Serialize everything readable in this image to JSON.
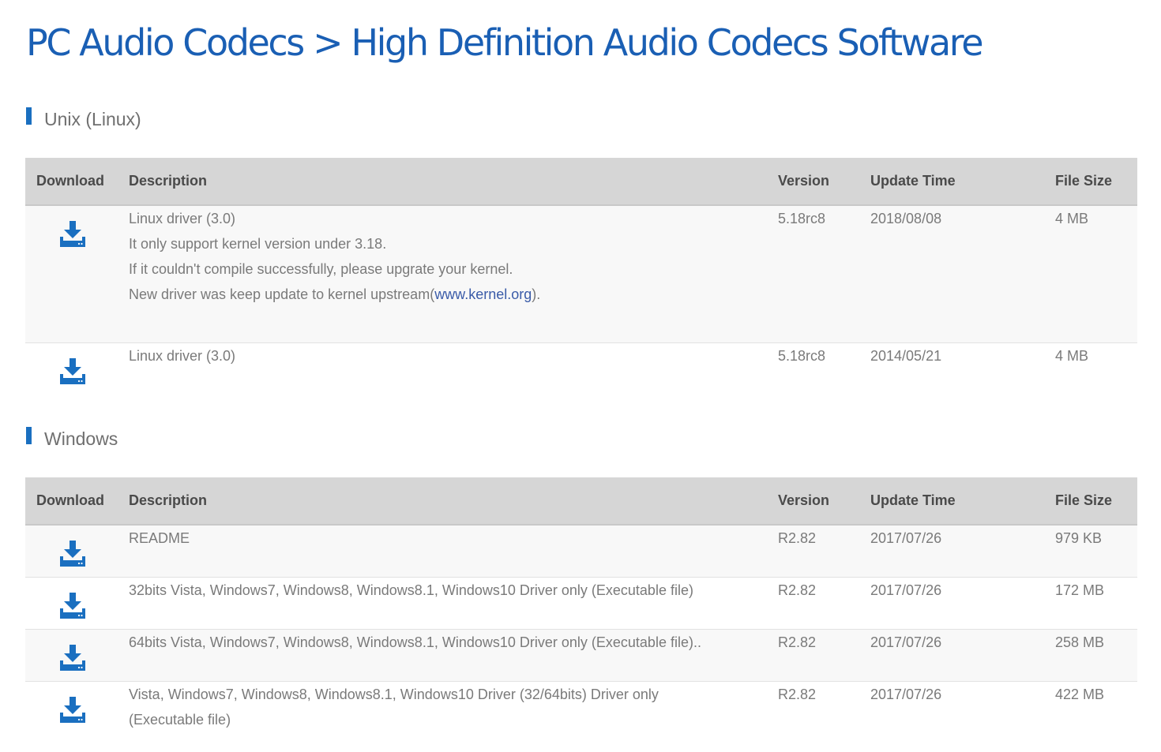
{
  "page": {
    "title": "PC Audio Codecs > High Definition Audio Codecs Software"
  },
  "table_headers": {
    "download": "Download",
    "description": "Description",
    "version": "Version",
    "update_time": "Update Time",
    "file_size": "File Size"
  },
  "icon": "download-icon",
  "accent_color": "#1a6fc0",
  "sections": {
    "linux": {
      "heading": "Unix (Linux)",
      "rows": [
        {
          "desc_line1": "Linux driver (3.0)",
          "desc_line2": "It only support kernel version under 3.18.",
          "desc_line3": "If it couldn't compile successfully, please upgrate your kernel.",
          "desc_line4_prefix": "New driver was keep update to kernel upstream(",
          "desc_link": "www.kernel.org",
          "desc_line4_suffix": ").",
          "version": "5.18rc8",
          "update_time": "2018/08/08",
          "file_size": "4 MB"
        },
        {
          "desc_line1": "Linux driver (3.0)",
          "version": "5.18rc8",
          "update_time": "2014/05/21",
          "file_size": "4 MB"
        }
      ]
    },
    "windows": {
      "heading": "Windows",
      "rows": [
        {
          "desc_line1": "README",
          "version": "R2.82",
          "update_time": "2017/07/26",
          "file_size": "979 KB"
        },
        {
          "desc_line1": "32bits Vista, Windows7, Windows8, Windows8.1, Windows10 Driver only (Executable file)",
          "version": "R2.82",
          "update_time": "2017/07/26",
          "file_size": "172 MB"
        },
        {
          "desc_line1": "64bits Vista, Windows7, Windows8, Windows8.1, Windows10 Driver only (Executable file)..",
          "version": "R2.82",
          "update_time": "2017/07/26",
          "file_size": "258 MB"
        },
        {
          "desc_line1": "Vista, Windows7, Windows8, Windows8.1, Windows10 Driver (32/64bits) Driver only",
          "desc_line2": "(Executable file)",
          "version": "R2.82",
          "update_time": "2017/07/26",
          "file_size": "422 MB"
        }
      ]
    }
  }
}
